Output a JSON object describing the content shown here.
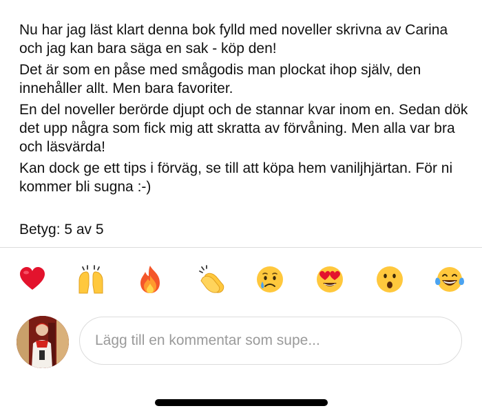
{
  "review": {
    "paragraphs": [
      "Nu har jag läst klart denna bok fylld med noveller skrivna av Carina och jag kan bara säga en sak - köp den!",
      "Det är som en påse med smågodis man plockat ihop själv, den innehåller allt. Men bara favoriter.",
      "En del noveller berörde djupt och de stannar kvar inom en. Sedan dök det upp några som fick mig att skratta av förvåning. Men alla var bra och läsvärda!",
      "Kan dock ge ett tips i förväg, se till att köpa hem vaniljhjärtan. För ni kommer bli sugna :-)"
    ],
    "rating_text": "Betyg: 5 av 5"
  },
  "reactions": [
    "red-heart-icon",
    "raising-hands-icon",
    "fire-icon",
    "clapping-hands-icon",
    "crying-face-icon",
    "heart-eyes-face-icon",
    "surprised-face-icon",
    "tears-of-joy-face-icon"
  ],
  "composer": {
    "placeholder": "Lägg till en kommentar som supe..."
  },
  "colors": {
    "divider": "#dbdbdb",
    "placeholder": "#9a9a9a",
    "emoji_yellow": "#ffc83d",
    "heart_red": "#e3132d"
  }
}
